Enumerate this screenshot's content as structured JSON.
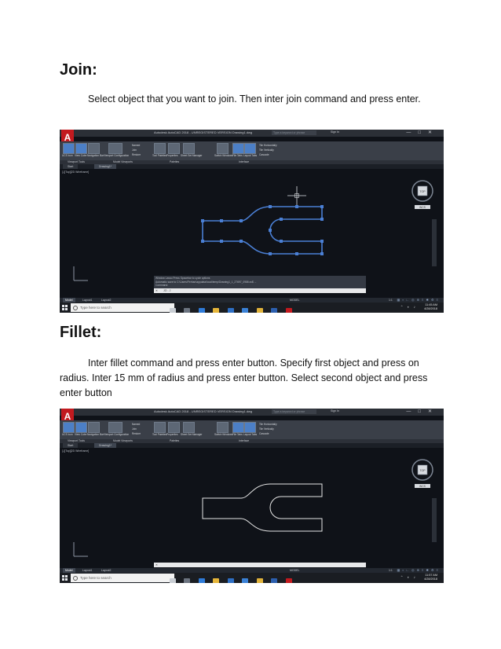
{
  "sections": [
    {
      "heading": "Join:",
      "paragraph": "Select object that you want to join. Then inter join command and press enter."
    },
    {
      "heading": "Fillet:",
      "paragraph": "Inter fillet command and press enter button. Specify first object and press on radius. Inter 15 mm of radius and press enter button. Select second object and press enter button"
    }
  ],
  "screens": [
    {
      "title_bar": "Autodesk AutoCAD 2018 - UNREGISTERED VERSION   Drawing1.dwg",
      "search_placeholder": "Type a keyword or phrase",
      "sign_in": "Sign In",
      "ribbon_tabs": [
        "Home",
        "Insert",
        "Annotate",
        "Parametric",
        "View",
        "Manage",
        "Output",
        "Add-ins",
        "A360",
        "Express Tools",
        "Featured Apps"
      ],
      "active_ribbon_tab": "View",
      "ribbon_labels": [
        "UCS Icon",
        "View Cube",
        "Navigation Bar",
        "Viewport Configuration",
        "Named",
        "Join",
        "Restore",
        "Tool Palettes",
        "Properties",
        "Sheet Set Manager",
        "Switch Windows",
        "File Tabs",
        "Layout Tabs",
        "Tile Horizontally",
        "Tile Vertically",
        "Cascade"
      ],
      "panel_labels": [
        "Viewport Tools",
        "Model Viewports",
        "Palettes",
        "Interface"
      ],
      "doc_tabs": [
        "Start",
        "Drawing1*"
      ],
      "viewport_label": "[-][Top][2D Wireframe]",
      "viewcube_label": "TOP",
      "wcs_label": "WCS",
      "command_history": [
        "Window Lasso   Press Spacebar to cycle options",
        "Automatic save to C:\\Users\\Ferhan\\appdata\\local\\temp\\Drawing1_1_27697_0986.sv$ ...",
        "Command:"
      ],
      "command_prompt": "JO - J",
      "status_tabs": [
        "Model",
        "Layout1",
        "Layout2"
      ],
      "status_model": "MODEL",
      "scale": "1:1",
      "taskbar_search": "Type here to search",
      "clock_time": "11:45 AM",
      "clock_date": "4/28/2018"
    },
    {
      "title_bar": "Autodesk AutoCAD 2018 - UNREGISTERED VERSION   Drawing1.dwg",
      "search_placeholder": "Type a keyword or phrase",
      "sign_in": "Sign In",
      "ribbon_tabs": [
        "Home",
        "Insert",
        "Annotate",
        "Parametric",
        "View",
        "Manage",
        "Output",
        "Add-ins",
        "A360",
        "Express Tools",
        "Featured Apps"
      ],
      "active_ribbon_tab": "View",
      "ribbon_labels": [
        "UCS Icon",
        "View Cube",
        "Navigation Bar",
        "Viewport Configuration",
        "Named",
        "Join",
        "Restore",
        "Tool Palettes",
        "Properties",
        "Sheet Set Manager",
        "Switch Windows",
        "File Tabs",
        "Layout Tabs",
        "Tile Horizontally",
        "Tile Vertically",
        "Cascade"
      ],
      "panel_labels": [
        "Viewport Tools",
        "Model Viewports",
        "Palettes",
        "Interface"
      ],
      "doc_tabs": [
        "Start",
        "Drawing1*"
      ],
      "viewport_label": "[-][Top][2D Wireframe]",
      "viewcube_label": "TOP",
      "wcs_label": "WCS",
      "command_history": [],
      "command_prompt": "",
      "status_tabs": [
        "Model",
        "Layout1",
        "Layout2"
      ],
      "status_model": "MODEL",
      "scale": "1:1",
      "taskbar_search": "Type here to search",
      "clock_time": "11:57 AM",
      "clock_date": "4/28/2018"
    }
  ],
  "colors": {
    "drawing_canvas": "#0f1218",
    "join_outline": "#4a7fd4",
    "fillet_outline": "#e6e6e6",
    "autocad_red": "#c21a1f"
  }
}
